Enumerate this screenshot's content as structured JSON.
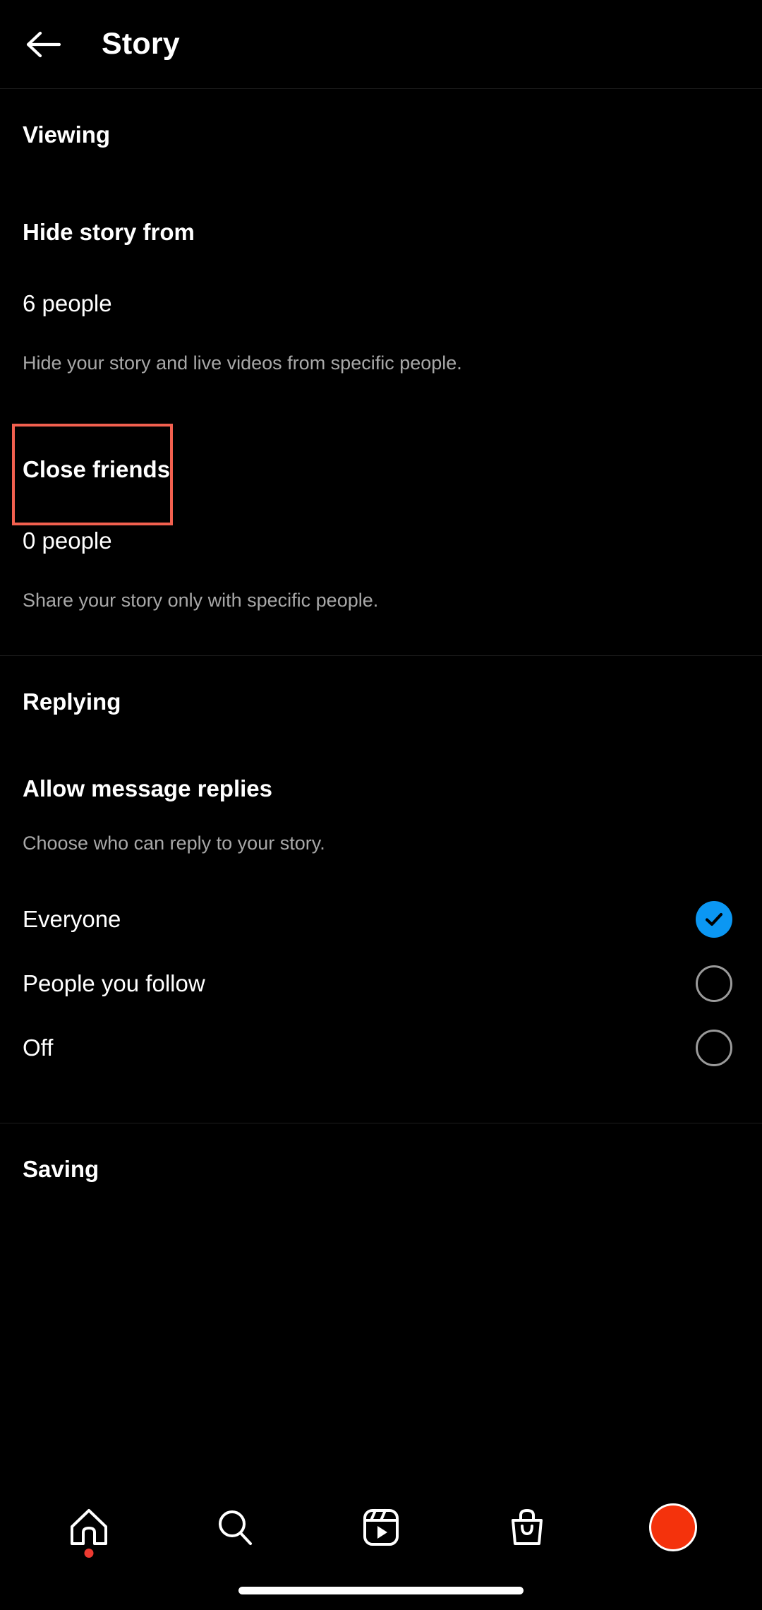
{
  "header": {
    "back_icon": "back-arrow-icon",
    "title": "Story"
  },
  "sections": {
    "viewing": {
      "header": "Viewing",
      "hide_story": {
        "title": "Hide story from",
        "value": "6 people",
        "description": "Hide your story and live videos from specific people."
      },
      "close_friends": {
        "title": "Close friends",
        "value": "0 people",
        "description": "Share your story only with specific people.",
        "highlight_color": "#f2604f"
      }
    },
    "replying": {
      "header": "Replying",
      "allow_message_replies": {
        "title": "Allow message replies",
        "description": "Choose who can reply to your story.",
        "options": [
          {
            "label": "Everyone",
            "selected": true
          },
          {
            "label": "People you follow",
            "selected": false
          },
          {
            "label": "Off",
            "selected": false
          }
        ],
        "selected_color": "#0b97f3"
      }
    },
    "saving": {
      "header": "Saving"
    }
  },
  "bottom_nav": {
    "items": [
      {
        "icon": "home-icon",
        "has_dot": true
      },
      {
        "icon": "search-icon",
        "has_dot": false
      },
      {
        "icon": "reels-icon",
        "has_dot": false
      },
      {
        "icon": "shop-bag-icon",
        "has_dot": false
      },
      {
        "icon": "profile-avatar-icon",
        "has_dot": false
      }
    ],
    "avatar_color": "#f4320c",
    "dot_color": "#ec3a31"
  }
}
